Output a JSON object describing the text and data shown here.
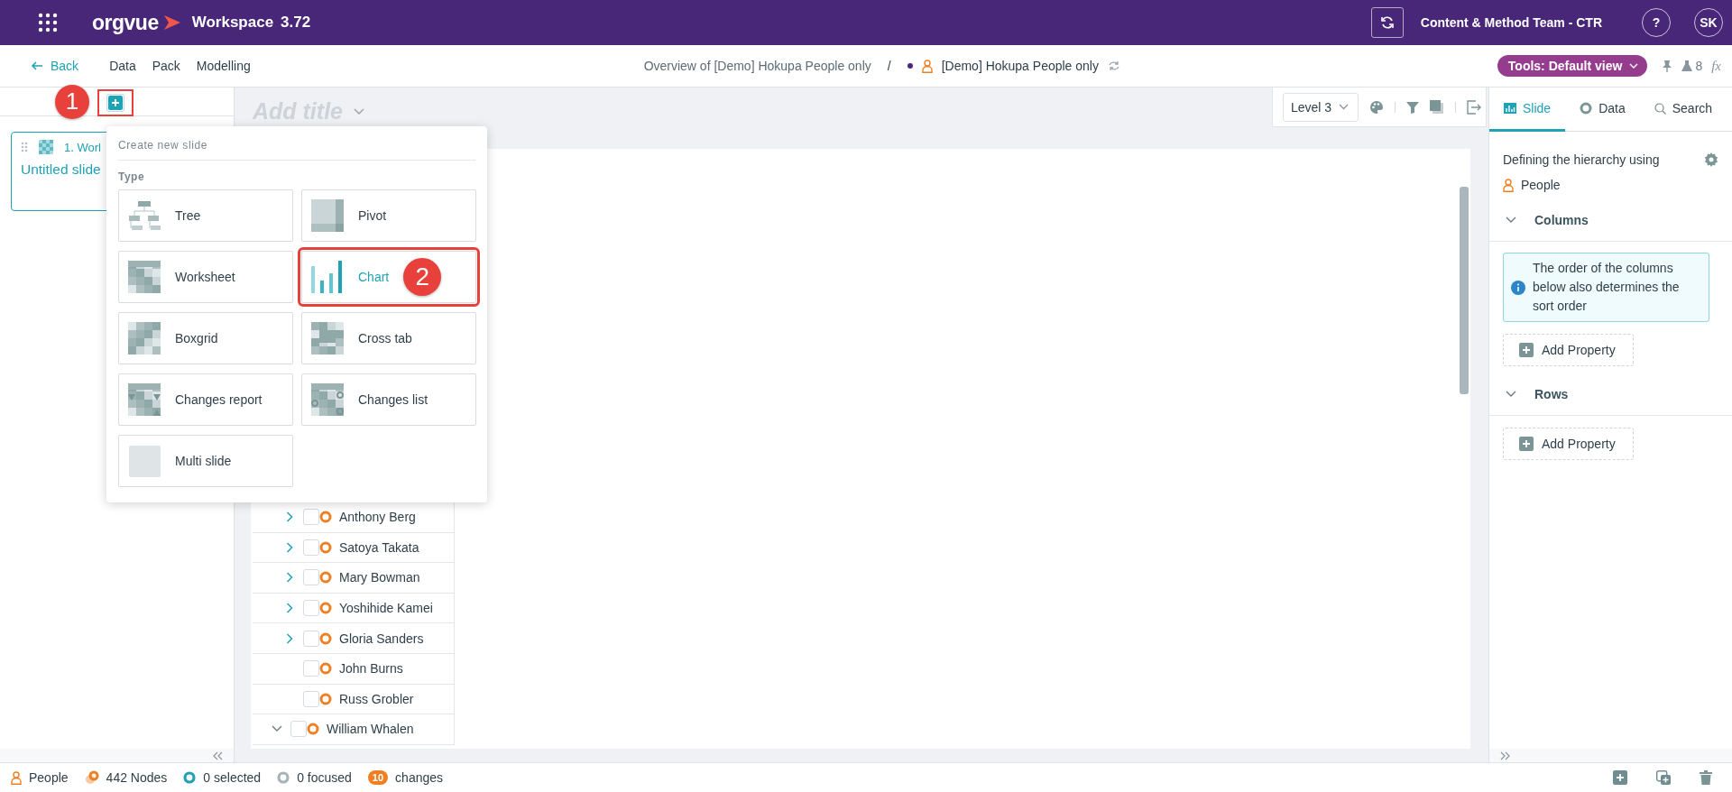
{
  "app_bar": {
    "logo": "orgvue",
    "product": "Workspace",
    "version": "3.72",
    "team": "Content & Method Team - CTR",
    "help": "?",
    "avatar": "SK"
  },
  "nav": {
    "back": "Back",
    "menus": [
      "Data",
      "Pack",
      "Modelling"
    ],
    "breadcrumb": "Overview of [Demo] Hokupa People only",
    "separator": "/",
    "dataset": "[Demo] Hokupa People only",
    "tools": "Tools: Default view",
    "flask_count": "8",
    "formula": "fx"
  },
  "annotations": [
    {
      "label": "1"
    },
    {
      "label": "2"
    }
  ],
  "slides_panel": {
    "slides": [
      {
        "heading": "1. Worl",
        "title": "Untitled slide",
        "selected": true
      }
    ]
  },
  "canvas": {
    "title_placeholder": "Add title",
    "level": "Level 3",
    "tree": [
      {
        "children": [
          {
            "label": "Anthony Berg",
            "expanded": false,
            "checked": false
          },
          {
            "label": "Satoya Takata",
            "expanded": false,
            "checked": false
          },
          {
            "label": "Mary Bowman",
            "expanded": false,
            "checked": false
          },
          {
            "label": "Yoshihide Kamei",
            "expanded": false,
            "checked": false
          },
          {
            "label": "Gloria Sanders",
            "expanded": false,
            "checked": false
          },
          {
            "label": "John Burns",
            "checked": false
          },
          {
            "label": "Russ Grobler",
            "checked": false
          }
        ]
      },
      {
        "label": "William Whalen",
        "expanded": true,
        "checked": false
      }
    ]
  },
  "new_slide_menu": {
    "heading": "Create new slide",
    "type_label": "Type",
    "types": [
      {
        "kind": "tree",
        "label": "Tree",
        "highlighted": false
      },
      {
        "kind": "pivot",
        "label": "Pivot",
        "highlighted": false
      },
      {
        "kind": "worksheet",
        "label": "Worksheet",
        "highlighted": false
      },
      {
        "kind": "chart",
        "label": "Chart",
        "highlighted": true
      },
      {
        "kind": "boxgrid",
        "label": "Boxgrid",
        "highlighted": false
      },
      {
        "kind": "crosstab",
        "label": "Cross tab",
        "highlighted": false
      },
      {
        "kind": "changes_report",
        "label": "Changes report",
        "highlighted": false
      },
      {
        "kind": "changes_list",
        "label": "Changes list",
        "highlighted": false
      },
      {
        "kind": "multi",
        "label": "Multi slide",
        "highlighted": false
      }
    ]
  },
  "inspector": {
    "tabs": [
      {
        "label": "Slide",
        "selected": true
      },
      {
        "label": "Data",
        "selected": false
      },
      {
        "label": "Search",
        "selected": false
      }
    ],
    "hierarchy_label": "Defining the hierarchy using",
    "hierarchy_source": "People",
    "sections": [
      {
        "title": "Columns",
        "expanded": true,
        "note": "The order of the columns below also determines the sort order",
        "action": "Add Property"
      },
      {
        "title": "Rows",
        "expanded": true,
        "action": "Add Property"
      }
    ]
  },
  "status_bar": {
    "items": [
      {
        "kind": "dataset",
        "label": "People"
      },
      {
        "kind": "nodes",
        "label": "442 Nodes"
      },
      {
        "kind": "selected",
        "label": "0 selected"
      },
      {
        "kind": "focused",
        "label": "0 focused"
      },
      {
        "kind": "changes",
        "count": "10",
        "label": "changes"
      }
    ]
  }
}
